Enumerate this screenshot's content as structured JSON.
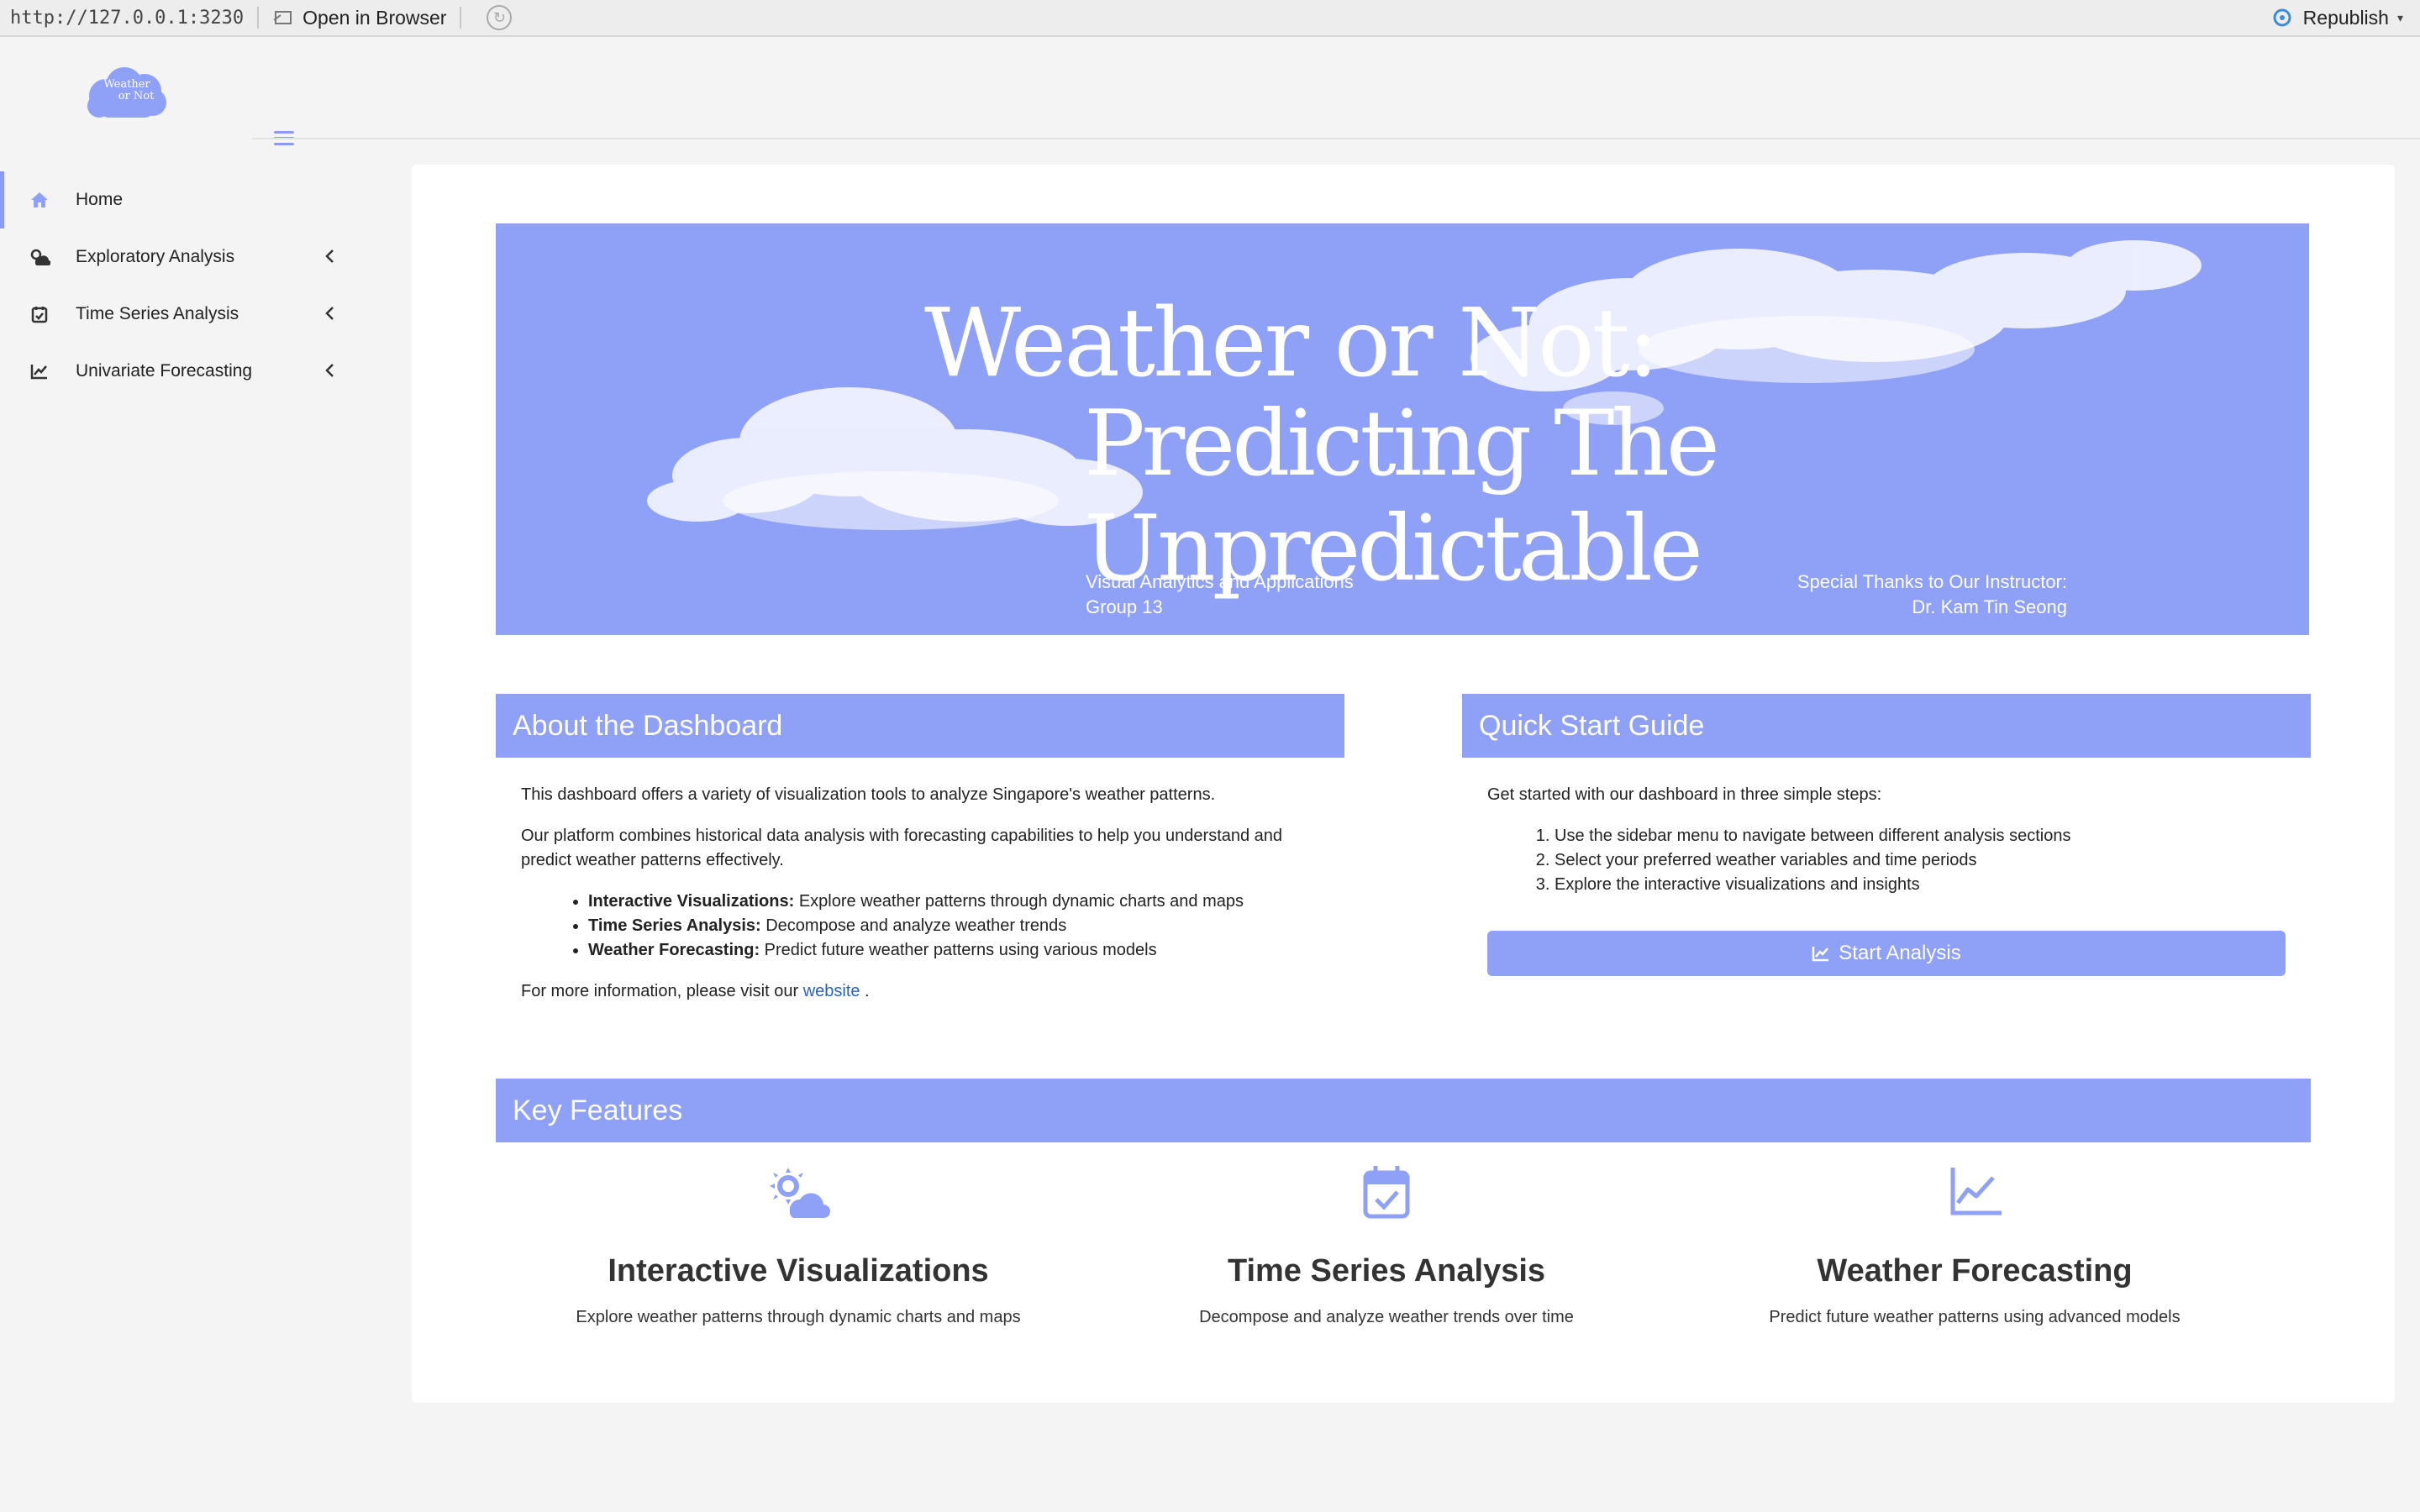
{
  "browser": {
    "url": "http://127.0.0.1:3230",
    "open_in_browser": "Open in Browser",
    "republish": "Republish"
  },
  "sidebar": {
    "logo_text_line1": "Weather",
    "logo_text_line2": "or Not",
    "items": [
      {
        "label": "Home",
        "icon": "home-icon",
        "active": true
      },
      {
        "label": "Exploratory Analysis",
        "icon": "cloud-sun-icon"
      },
      {
        "label": "Time Series Analysis",
        "icon": "calendar-check-icon"
      },
      {
        "label": "Univariate Forecasting",
        "icon": "line-chart-icon"
      }
    ]
  },
  "banner": {
    "title_line1": "Weather or Not:",
    "title_line2": "Predicting The Unpredictable",
    "left_line1": "Visual Analytics and Applications",
    "left_line2": "Group 13",
    "right_line1": "Special Thanks to Our Instructor:",
    "right_line2": "Dr. Kam Tin Seong"
  },
  "about": {
    "heading": "About the Dashboard",
    "p1": "This dashboard offers a variety of visualization tools to analyze Singapore's weather patterns.",
    "p2": "Our platform combines historical data analysis with forecasting capabilities to help you understand and predict weather patterns effectively.",
    "bullets": [
      {
        "bold": "Interactive Visualizations:",
        "text": " Explore weather patterns through dynamic charts and maps"
      },
      {
        "bold": "Time Series Analysis:",
        "text": " Decompose and analyze weather trends"
      },
      {
        "bold": "Weather Forecasting:",
        "text": " Predict future weather patterns using various models"
      }
    ],
    "more_prefix": "For more information, please visit our ",
    "more_link": "website",
    "more_suffix": " ."
  },
  "quick_start": {
    "heading": "Quick Start Guide",
    "intro": "Get started with our dashboard in three simple steps:",
    "steps": [
      "Use the sidebar menu to navigate between different analysis sections",
      "Select your preferred weather variables and time periods",
      "Explore the interactive visualizations and insights"
    ],
    "button": "Start Analysis"
  },
  "key_features": {
    "heading": "Key Features",
    "items": [
      {
        "title": "Interactive Visualizations",
        "desc": "Explore weather patterns through dynamic charts and maps",
        "icon": "cloud-sun-icon"
      },
      {
        "title": "Time Series Analysis",
        "desc": "Decompose and analyze weather trends over time",
        "icon": "calendar-check-icon"
      },
      {
        "title": "Weather Forecasting",
        "desc": "Predict future weather patterns using advanced models",
        "icon": "line-chart-icon"
      }
    ]
  },
  "colors": {
    "accent": "#8fa0f7",
    "link": "#2a63b6"
  }
}
